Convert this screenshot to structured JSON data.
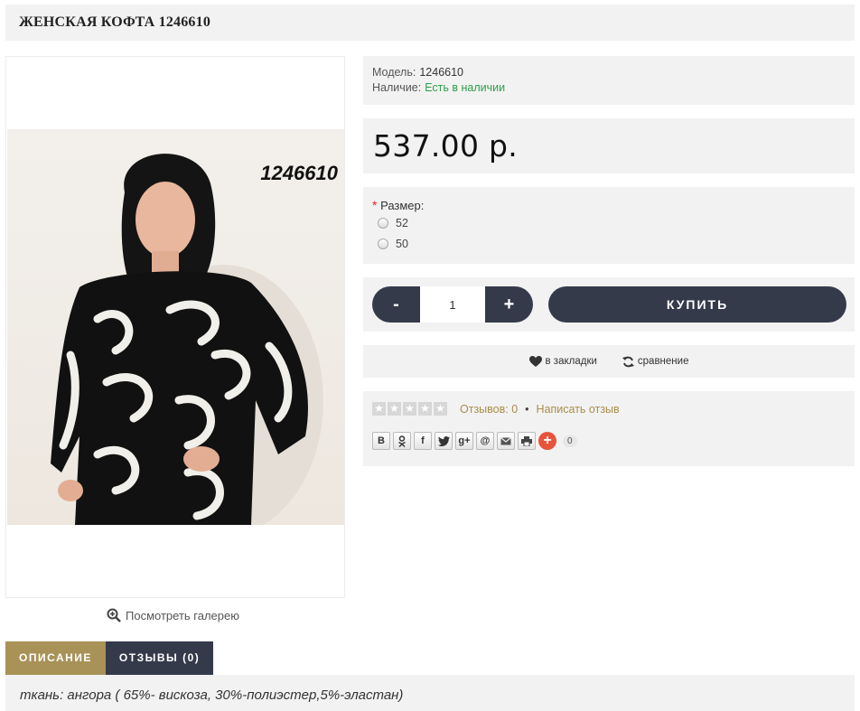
{
  "product": {
    "title": "ЖЕНСКАЯ КОФТА 1246610",
    "image_code": "1246610"
  },
  "gallery": {
    "label": "Посмотреть галерею"
  },
  "info": {
    "model_label": "Модель:",
    "model_value": "1246610",
    "availability_label": "Наличие:",
    "availability_value": "Есть в наличии"
  },
  "price": "537.00 р.",
  "options": {
    "required_mark": "*",
    "size_label": "Размер:",
    "sizes": [
      "52",
      "50"
    ]
  },
  "cart": {
    "minus": "-",
    "quantity": "1",
    "plus": "+",
    "buy_label": "КУПИТЬ"
  },
  "actions": {
    "wishlist": "в закладки",
    "compare": "сравнение"
  },
  "reviews": {
    "rating_stars": 0,
    "count_label": "Отзывов: 0",
    "separator": "•",
    "write_label": "Написать отзыв"
  },
  "share": {
    "buttons": [
      "В",
      "ok",
      "f",
      "tw",
      "g+",
      "@",
      "mail",
      "print"
    ],
    "count": "0"
  },
  "tabs": [
    {
      "label": "ОПИСАНИЕ",
      "active": true
    },
    {
      "label": "ОТЗЫВЫ (0)",
      "active": false
    }
  ],
  "description": "ткань: ангора ( 65%- вискоза, 30%-полиэстер,5%-эластан)",
  "colors": {
    "accent": "#a89257",
    "dark": "#353a4b",
    "in_stock": "#2e9f4a",
    "panel": "#f2f2f2"
  }
}
